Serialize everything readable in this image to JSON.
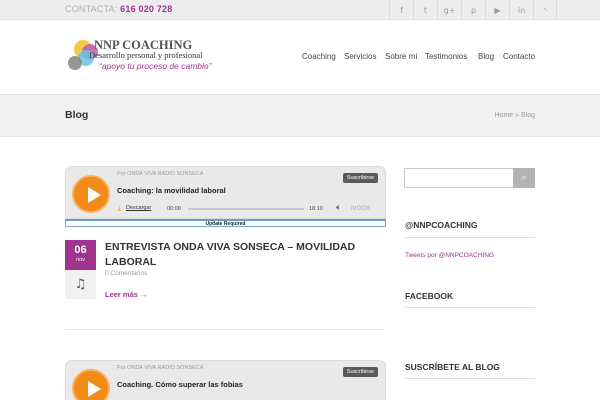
{
  "topbar": {
    "contact_label": "CONTACTA:",
    "phone": "616 020 728",
    "socials": [
      {
        "icon": "facebook-icon",
        "glyph": "f"
      },
      {
        "icon": "twitter-icon",
        "glyph": "t"
      },
      {
        "icon": "google-plus-icon",
        "glyph": "g+"
      },
      {
        "icon": "pinterest-icon",
        "glyph": "p"
      },
      {
        "icon": "youtube-icon",
        "glyph": "▶"
      },
      {
        "icon": "linkedin-icon",
        "glyph": "in"
      },
      {
        "icon": "rss-icon",
        "glyph": "◝"
      }
    ]
  },
  "logo": {
    "name": "NNP COACHING",
    "subtitle": "Desarrollo personal y profesional",
    "tagline": "“apoyo tu proceso de cambio”"
  },
  "nav": [
    "Coaching",
    "Servicios",
    "Sobre mí",
    "Testimonios",
    "Blog",
    "Contacto"
  ],
  "page": {
    "title": "Blog",
    "breadcrumb": "Home » Blog"
  },
  "posts": [
    {
      "player": {
        "by": "Por ONDA VIVA RADIO SONSECA",
        "title": "Coaching: la movilidad laboral",
        "subscribe": "Suscribirse",
        "download": "Descargar",
        "time_start": "00:00",
        "time_end": "18:10",
        "brand": "iVOOX",
        "update_notice": "Update Required"
      },
      "day": "06",
      "month": "nov",
      "title": "ENTREVISTA ONDA VIVA SONSECA – MOVILIDAD LABORAL",
      "comments": "0 Comentarios",
      "read_more": "Leer más →"
    },
    {
      "player": {
        "by": "Por ONDA VIVA RADIO SONSECA",
        "title": "Coaching. Cómo superar las fobias",
        "subscribe": "Suscribirse"
      }
    }
  ],
  "sidebar": {
    "search_icon": "⌕",
    "widgets": [
      {
        "title": "@NNPCOACHING",
        "link": "Tweets por @NNPCOACHING"
      },
      {
        "title": "FACEBOOK"
      },
      {
        "title": "SUSCRÍBETE AL BLOG"
      }
    ]
  },
  "colors": {
    "accent": "#a0338e",
    "player_orange": "#f28a17"
  }
}
